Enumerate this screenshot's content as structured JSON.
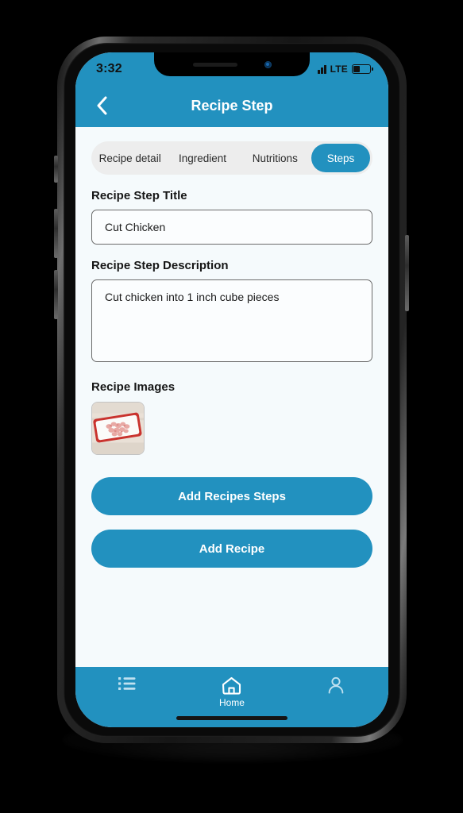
{
  "status_bar": {
    "time": "3:32",
    "network": "LTE",
    "battery_percent": 42,
    "signal_icon": "signal-bars-icon",
    "battery_icon": "battery-icon"
  },
  "app_bar": {
    "back_icon": "chevron-left-icon",
    "title": "Recipe Step"
  },
  "tabs": [
    {
      "label": "Recipe detail",
      "active": false
    },
    {
      "label": "Ingredient",
      "active": false
    },
    {
      "label": "Nutritions",
      "active": false
    },
    {
      "label": "Steps",
      "active": true
    }
  ],
  "form": {
    "title_label": "Recipe Step Title",
    "title_value": "Cut Chicken",
    "title_placeholder": "Recipe Step Title",
    "description_label": "Recipe Step Description",
    "description_value": "Cut chicken into 1 inch cube pieces",
    "description_placeholder": "Recipe Step Description",
    "images_label": "Recipe Images",
    "image_alt": "diced-chicken-on-cutting-board"
  },
  "actions": {
    "add_steps_label": "Add Recipes Steps",
    "add_recipe_label": "Add Recipe"
  },
  "bottom_nav": [
    {
      "icon": "list-icon",
      "label": ""
    },
    {
      "icon": "home-icon",
      "label": "Home"
    },
    {
      "icon": "person-icon",
      "label": ""
    }
  ],
  "colors": {
    "brand_blue": "#2291BF",
    "content_bg": "#F5FAFC",
    "tab_track": "#EDEDED",
    "field_border": "#6B6B6B"
  }
}
